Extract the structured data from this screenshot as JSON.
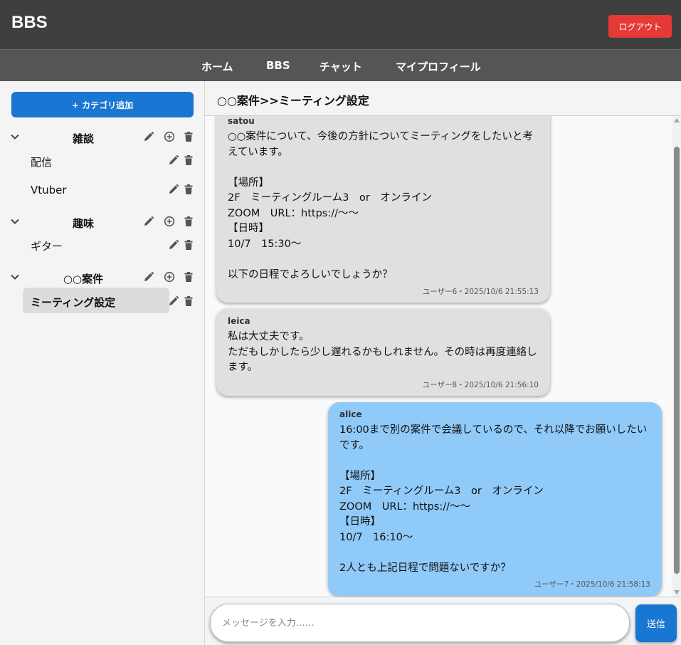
{
  "app": {
    "title": "BBS",
    "logout_label": "ログアウト"
  },
  "nav": {
    "items": [
      "ホーム",
      "BBS",
      "チャット",
      "マイプロフィール"
    ]
  },
  "sidebar": {
    "add_category_label": "+ カテゴリ追加",
    "categories": [
      {
        "label": "雑談",
        "subcategories": [
          "配信",
          "Vtuber"
        ]
      },
      {
        "label": "趣味",
        "subcategories": [
          "ギター"
        ]
      },
      {
        "label": "○○案件",
        "subcategories": [
          "ミーティング設定"
        ]
      }
    ],
    "active_subcategory": "ミーティング設定"
  },
  "thread": {
    "title": "○○案件>>ミーティング設定",
    "messages": [
      {
        "author": "satou",
        "text": "○○案件について、今後の方針についてミーティングをしたいと考えています。\n\n【場所】\n2F　ミーティングルーム3　or　オンライン\nZOOM　URL：https://～～\n【日時】\n10/7　15:30～\n\n以下の日程でよろしいでしょうか？",
        "meta": "ユーザー6・2025/10/6 21:55:13",
        "mine": false
      },
      {
        "author": "leica",
        "text": "私は大丈夫です。\nただもしかしたら少し遅れるかもしれません。その時は再度連絡します。",
        "meta": "ユーザー8・2025/10/6 21:56:10",
        "mine": false
      },
      {
        "author": "alice",
        "text": "16:00まで別の案件で会議しているので、それ以降でお願いしたいです。\n\n【場所】\n2F　ミーティングルーム3　or　オンライン\nZOOM　URL：https://～～\n【日時】\n10/7　16:10～\n\n2人とも上記日程で問題ないですか？",
        "meta": "ユーザー7・2025/10/6 21:58:13",
        "mine": true
      }
    ]
  },
  "composer": {
    "placeholder": "メッセージを入力……",
    "send_label": "送信"
  },
  "colors": {
    "header_bg": "#3f3f3f",
    "nav_bg": "#555555",
    "logout": "#e53935",
    "primary": "#1976d2",
    "bubble_other": "#e0e0e0",
    "bubble_mine": "#90caf9"
  },
  "icons": {
    "edit": "pencil-icon",
    "add": "plus-circle-icon",
    "delete": "trash-icon",
    "collapse": "chevron-down-icon"
  }
}
